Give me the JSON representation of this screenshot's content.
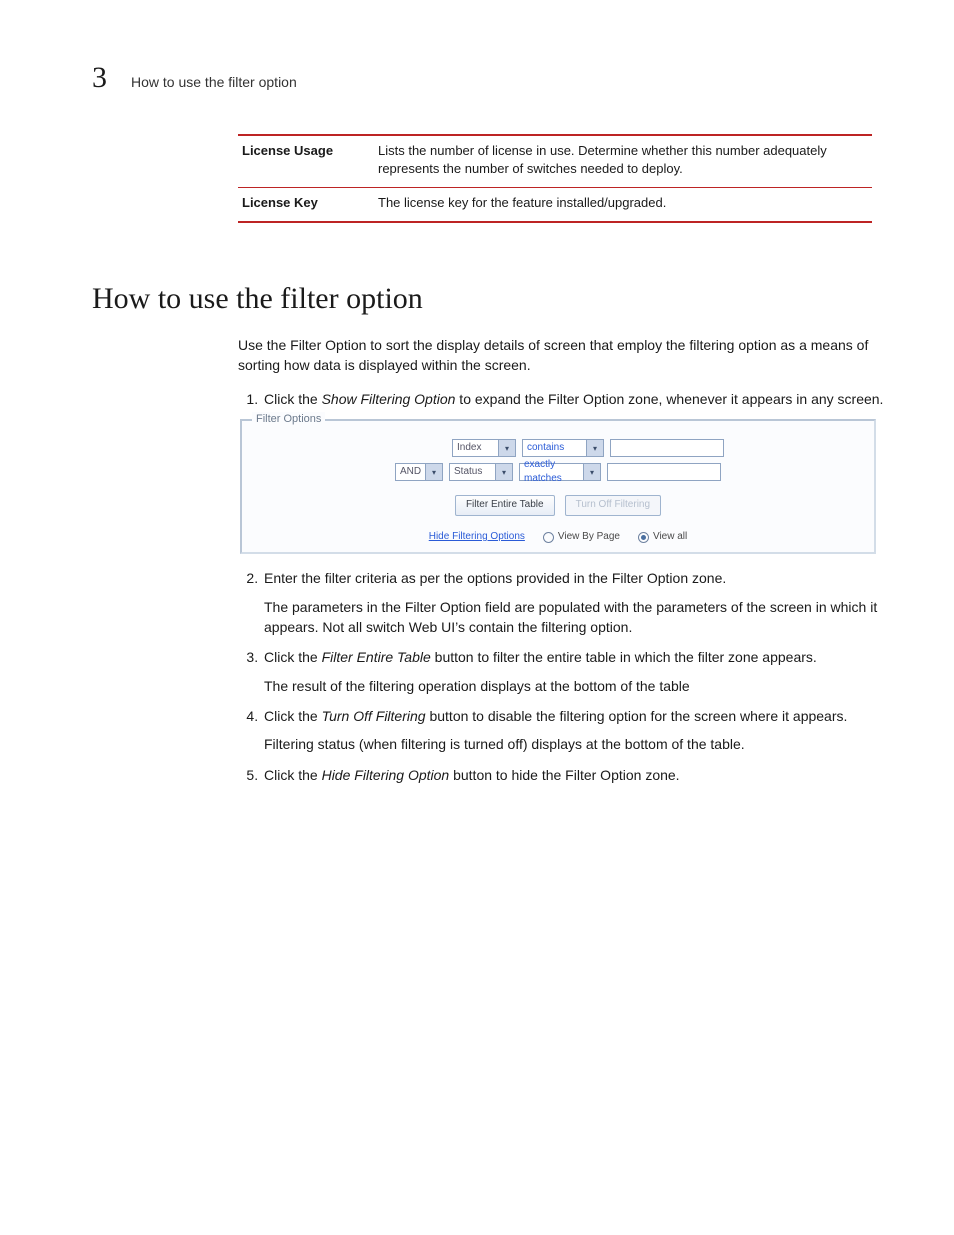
{
  "runhead": {
    "number": "3",
    "title": "How to use the filter option"
  },
  "license_table": [
    {
      "key": "License Usage",
      "val": "Lists the number of license in use. Determine whether this number adequately represents the number of switches needed to deploy."
    },
    {
      "key": "License Key",
      "val": "The license key for the feature installed/upgraded."
    }
  ],
  "heading": "How to use the filter option",
  "intro": "Use the Filter Option to sort the display details of screen that employ the filtering option as a means of sorting how data is displayed within the screen.",
  "steps": {
    "s1_pre": "Click the ",
    "s1_em": "Show Filtering Option",
    "s1_post": " to expand the Filter Option zone, whenever it appears in any screen.",
    "s2": "Enter the filter criteria as per the options provided in the Filter Option zone.",
    "s2_note": "The parameters in the Filter Option field are populated with the parameters of the screen in which it appears. Not all switch Web UI’s contain the filtering option.",
    "s3_pre": "Click the ",
    "s3_em": "Filter Entire Table",
    "s3_post": " button to filter the entire table in which the filter zone appears.",
    "s3_note": "The result of the filtering operation displays at the bottom of the table",
    "s4_pre": "Click the ",
    "s4_em": "Turn Off Filtering",
    "s4_post": " button to disable the filtering option for the screen where it appears.",
    "s4_note": "Filtering status (when filtering is turned off) displays at the bottom of the table.",
    "s5_pre": "Click the ",
    "s5_em": "Hide Filtering Option",
    "s5_post": " button to hide the Filter Option zone."
  },
  "filterui": {
    "legend": "Filter Options",
    "logic": "AND",
    "field1": "Index",
    "op1": "contains",
    "field2": "Status",
    "op2": "exactly matches",
    "btn_filter": "Filter Entire Table",
    "btn_off": "Turn Off Filtering",
    "hide_link": "Hide Filtering Options",
    "radio_page": "View By Page",
    "radio_all": "View all"
  }
}
